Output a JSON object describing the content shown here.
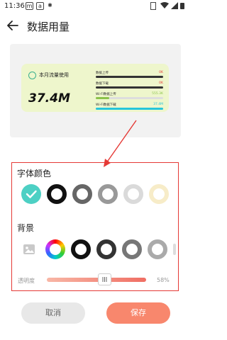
{
  "status_bar": {
    "time": "11:36",
    "icons_left": [
      "m",
      "a"
    ],
    "icons_right": [
      "vibrate-icon",
      "wifi-icon",
      "signal-icon",
      "battery-icon"
    ]
  },
  "header": {
    "title": "数据用量"
  },
  "widget": {
    "title": "本月流量使用",
    "value": "37.4M",
    "bars": [
      {
        "label": "数据上传",
        "value": "0K",
        "value_color": "#e53935",
        "fill": 0.0,
        "fill_color": "#333333"
      },
      {
        "label": "数据下载",
        "value": "0K",
        "value_color": "#e53935",
        "fill": 0.0,
        "fill_color": "#333333"
      },
      {
        "label": "Wi-Fi数据上传",
        "value": "555.3K",
        "value_color": "#8bc34a",
        "fill": 0.2,
        "fill_color": "#8bc34a"
      },
      {
        "label": "Wi-Fi数据下载",
        "value": "37.4M",
        "value_color": "#26c6da",
        "fill": 1.0,
        "fill_color": "#26c6da"
      }
    ]
  },
  "font_color": {
    "label": "字体颜色"
  },
  "background": {
    "label": "背景"
  },
  "opacity": {
    "label": "透明度",
    "value": "58%",
    "level": 0.55
  },
  "buttons": {
    "cancel": "取消",
    "save": "保存"
  },
  "colors": {
    "accent": "#f8876d",
    "annotation": "#e53935",
    "widget_bg": "#eef6cc",
    "selected": "#4dd0c4"
  }
}
